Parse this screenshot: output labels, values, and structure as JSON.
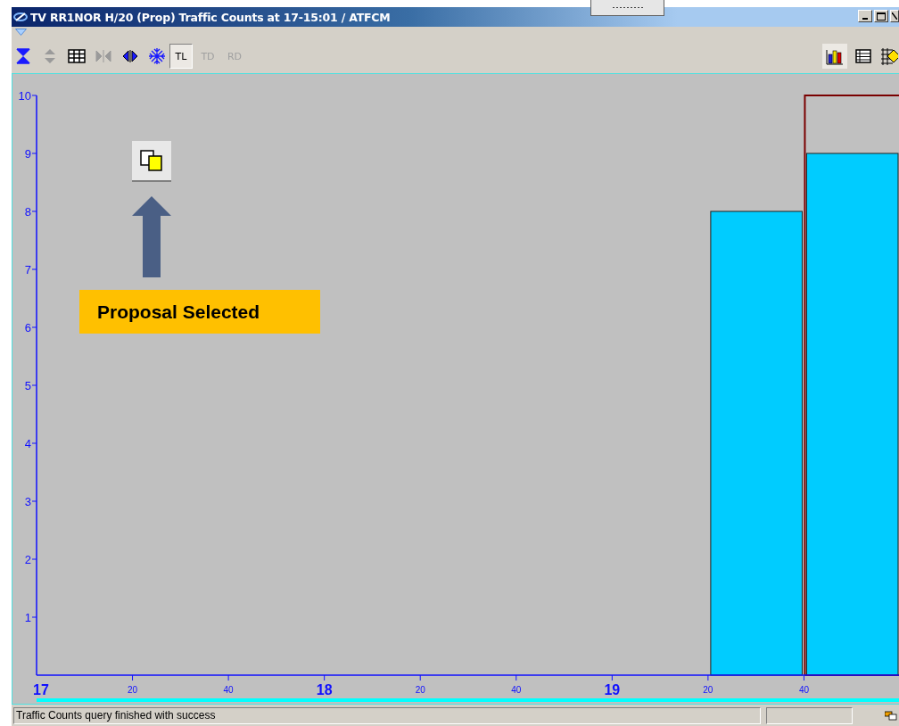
{
  "window": {
    "title": "TV RR1NOR H/20 (Prop) Traffic Counts at 17-15:01 / ATFCM"
  },
  "toolbar": {
    "left_tools": [
      {
        "kind": "icon",
        "disabled": false
      },
      {
        "kind": "icon",
        "disabled": true
      },
      {
        "kind": "icon",
        "disabled": false
      },
      {
        "kind": "icon",
        "disabled": true
      },
      {
        "kind": "icon",
        "disabled": false
      },
      {
        "kind": "icon",
        "disabled": false
      },
      {
        "kind": "text",
        "label": "TL",
        "pressed": true,
        "disabled": false
      },
      {
        "kind": "text",
        "label": "TD",
        "pressed": false,
        "disabled": true
      },
      {
        "kind": "text",
        "label": "RD",
        "pressed": false,
        "disabled": true
      }
    ],
    "right_tools": [
      {
        "pressed": true
      },
      {
        "pressed": false
      },
      {
        "pressed": false
      }
    ]
  },
  "chart": {
    "chart_data": {
      "type": "bar",
      "x": [
        19.5,
        19.8333
      ],
      "values": [
        8,
        9
      ],
      "xlim": [
        17,
        20
      ],
      "ylim": [
        0,
        10
      ],
      "yticks": [
        1,
        2,
        3,
        4,
        5,
        6,
        7,
        8,
        9,
        10
      ],
      "xticks": [
        17,
        18,
        19
      ]
    },
    "x_minor_labels": [
      "20",
      "40",
      "20",
      "40",
      "20",
      "40"
    ],
    "bars": [
      {
        "selected": false
      },
      {
        "selected": true
      }
    ]
  },
  "callout": {
    "label": "Proposal Selected"
  },
  "status_bar": {
    "message": "Traffic Counts query finished with success"
  }
}
